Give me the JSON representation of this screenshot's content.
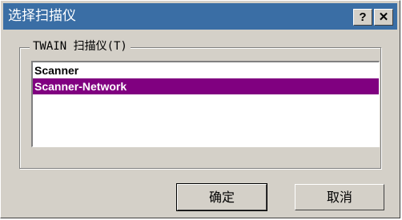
{
  "window": {
    "title": "选择扫描仪",
    "help_label": "?",
    "close_label": "✕"
  },
  "group": {
    "label": "TWAIN 扫描仪(T)"
  },
  "scanners": [
    {
      "label": "Scanner",
      "selected": false
    },
    {
      "label": "Scanner-Network",
      "selected": true
    }
  ],
  "buttons": {
    "ok_label": "确定",
    "cancel_label": "取消"
  },
  "colors": {
    "titlebar": "#3a6ea5",
    "face": "#d4d0c8",
    "selection": "#800080"
  }
}
